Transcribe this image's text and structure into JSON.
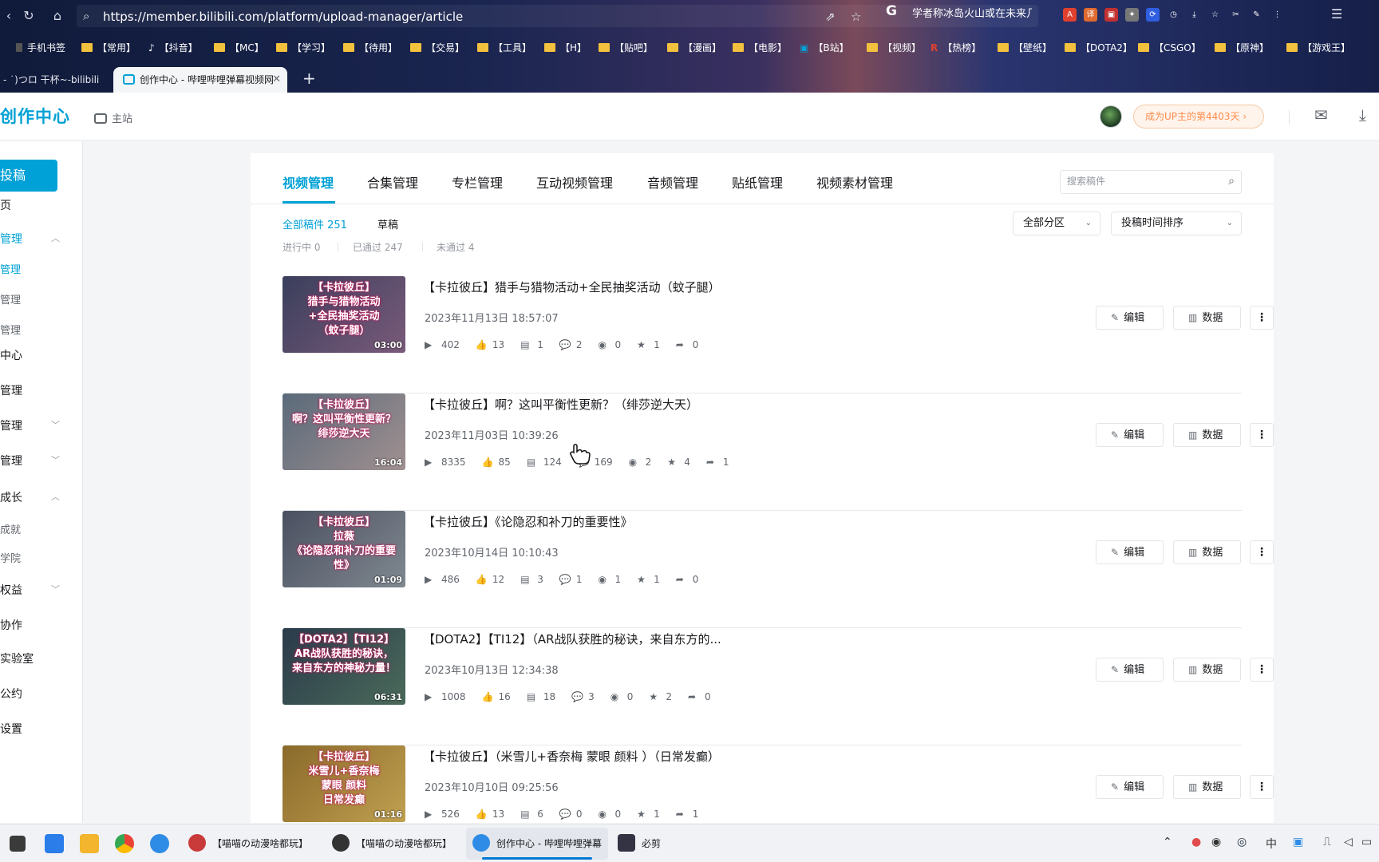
{
  "browser": {
    "url": "https://member.bilibili.com/platform/upload-manager/article",
    "hot_search": "学者称冰岛火山或在未来几",
    "bookmarks": [
      {
        "label": "手机书签",
        "type": "folder-dark"
      },
      {
        "label": "【常用】",
        "type": "folder"
      },
      {
        "label": "【抖音】",
        "type": "tiktok"
      },
      {
        "label": "【MC】",
        "type": "folder"
      },
      {
        "label": "【学习】",
        "type": "folder"
      },
      {
        "label": "【待用】",
        "type": "folder"
      },
      {
        "label": "【交易】",
        "type": "folder"
      },
      {
        "label": "【工具】",
        "type": "folder"
      },
      {
        "label": "【H】",
        "type": "folder"
      },
      {
        "label": "【贴吧】",
        "type": "folder"
      },
      {
        "label": "【漫画】",
        "type": "folder"
      },
      {
        "label": "【电影】",
        "type": "folder"
      },
      {
        "label": "【B站】",
        "type": "bili"
      },
      {
        "label": "【视频】",
        "type": "folder"
      },
      {
        "label": "【热榜】",
        "type": "r"
      },
      {
        "label": "【壁纸】",
        "type": "folder"
      },
      {
        "label": "【DOTA2】",
        "type": "folder"
      },
      {
        "label": "【CSGO】",
        "type": "folder"
      },
      {
        "label": "【原神】",
        "type": "folder"
      },
      {
        "label": "【游戏王】",
        "type": "folder"
      }
    ],
    "tabs": {
      "inactive": "- ˙)つロ 干杯~-bilibili",
      "active": "创作中心 - 哔哩哔哩弹幕视频网"
    }
  },
  "header": {
    "logo": "创作中心",
    "home_link": "主站",
    "up_badge": "成为UP主的第4403天"
  },
  "sidebar": {
    "post_button": "投稿",
    "items": [
      {
        "label": "页",
        "kind": "item",
        "chevron": ""
      },
      {
        "label": "管理",
        "kind": "item-active",
        "chevron": "up"
      },
      {
        "label": "管理",
        "kind": "sub-active",
        "chevron": ""
      },
      {
        "label": "管理",
        "kind": "sub",
        "chevron": ""
      },
      {
        "label": "管理",
        "kind": "sub",
        "chevron": ""
      },
      {
        "label": "中心",
        "kind": "item",
        "chevron": ""
      },
      {
        "label": "管理",
        "kind": "item",
        "chevron": ""
      },
      {
        "label": "管理",
        "kind": "item",
        "chevron": "down"
      },
      {
        "label": "管理",
        "kind": "item",
        "chevron": "down"
      },
      {
        "label": "成长",
        "kind": "item",
        "chevron": "up"
      },
      {
        "label": "成就",
        "kind": "sub",
        "chevron": ""
      },
      {
        "label": "学院",
        "kind": "sub",
        "chevron": ""
      },
      {
        "label": "权益",
        "kind": "item",
        "chevron": "down"
      },
      {
        "label": "协作",
        "kind": "item",
        "chevron": ""
      },
      {
        "label": "实验室",
        "kind": "item",
        "chevron": ""
      },
      {
        "label": "公约",
        "kind": "item",
        "chevron": ""
      },
      {
        "label": "设置",
        "kind": "item",
        "chevron": ""
      }
    ]
  },
  "main": {
    "tabs": [
      "视频管理",
      "合集管理",
      "专栏管理",
      "互动视频管理",
      "音频管理",
      "贴纸管理",
      "视频素材管理"
    ],
    "search_placeholder": "搜索稿件",
    "filter_all": "全部稿件 251",
    "filter_draft": "草稿",
    "status_in_progress": "进行中 0",
    "status_passed": "已通过 247",
    "status_failed": "未通过 4",
    "zone_select": "全部分区",
    "sort_select": "投稿时间排序",
    "edit_label": "编辑",
    "data_label": "数据",
    "videos": [
      {
        "title": "【卡拉彼丘】猎手与猎物活动+全民抽奖活动（蚊子腿）",
        "date": "2023年11月13日 18:57:07",
        "duration": "03:00",
        "thumb_text": "【卡拉彼丘】\n猎手与猎物活动\n+全民抽奖活动\n（蚊子腿）",
        "thumb_colors": [
          "#3a3f5c",
          "#7a5a7a"
        ],
        "views": "402",
        "likes": "13",
        "danmaku": "1",
        "comments": "2",
        "coins": "0",
        "favorites": "1",
        "shares": "0"
      },
      {
        "title": "【卡拉彼丘】啊？这叫平衡性更新？（绯莎逆大天）",
        "date": "2023年11月03日 10:39:26",
        "duration": "16:04",
        "thumb_text": "【卡拉彼丘】\n啊？这叫平衡性更新？\n绯莎逆大天",
        "thumb_colors": [
          "#5a6a7a",
          "#a09090"
        ],
        "views": "8335",
        "likes": "85",
        "danmaku": "124",
        "comments": "169",
        "coins": "2",
        "favorites": "4",
        "shares": "1"
      },
      {
        "title": "【卡拉彼丘】《论隐忍和补刀的重要性》",
        "date": "2023年10月14日 10:10:43",
        "duration": "01:09",
        "thumb_text": "【卡拉彼丘】\n拉薇\n《论隐忍和补刀的重要性》",
        "thumb_colors": [
          "#4a5060",
          "#808890"
        ],
        "views": "486",
        "likes": "12",
        "danmaku": "3",
        "comments": "1",
        "coins": "1",
        "favorites": "1",
        "shares": "0"
      },
      {
        "title": "【DOTA2】【TI12】（AR战队获胜的秘诀，来自东方的...",
        "date": "2023年10月13日 12:34:38",
        "duration": "06:31",
        "thumb_text": "【DOTA2】【TI12】\nAR战队获胜的秘诀，\n来自东方的神秘力量！",
        "thumb_colors": [
          "#2a3a4a",
          "#4a6a5a"
        ],
        "views": "1008",
        "likes": "16",
        "danmaku": "18",
        "comments": "3",
        "coins": "0",
        "favorites": "2",
        "shares": "0"
      },
      {
        "title": "【卡拉彼丘】（米雪儿+香奈梅 蒙眼 颜料 ）（日常发癫）",
        "date": "2023年10月10日 09:25:56",
        "duration": "01:16",
        "thumb_text": "【卡拉彼丘】\n米雪儿+香奈梅\n蒙眼 颜料\n日常发癫",
        "thumb_colors": [
          "#8a6a2a",
          "#c0a050"
        ],
        "views": "526",
        "likes": "13",
        "danmaku": "6",
        "comments": "0",
        "coins": "0",
        "favorites": "1",
        "shares": "1"
      }
    ]
  },
  "taskbar": {
    "apps": [
      {
        "label": "【喵喵の动漫啥都玩】",
        "active": false
      },
      {
        "label": "【喵喵の动漫啥都玩】",
        "active": false
      },
      {
        "label": "创作中心 - 哔哩哔哩弹幕",
        "active": true
      },
      {
        "label": "必剪",
        "active": false
      }
    ],
    "ime": "中"
  }
}
